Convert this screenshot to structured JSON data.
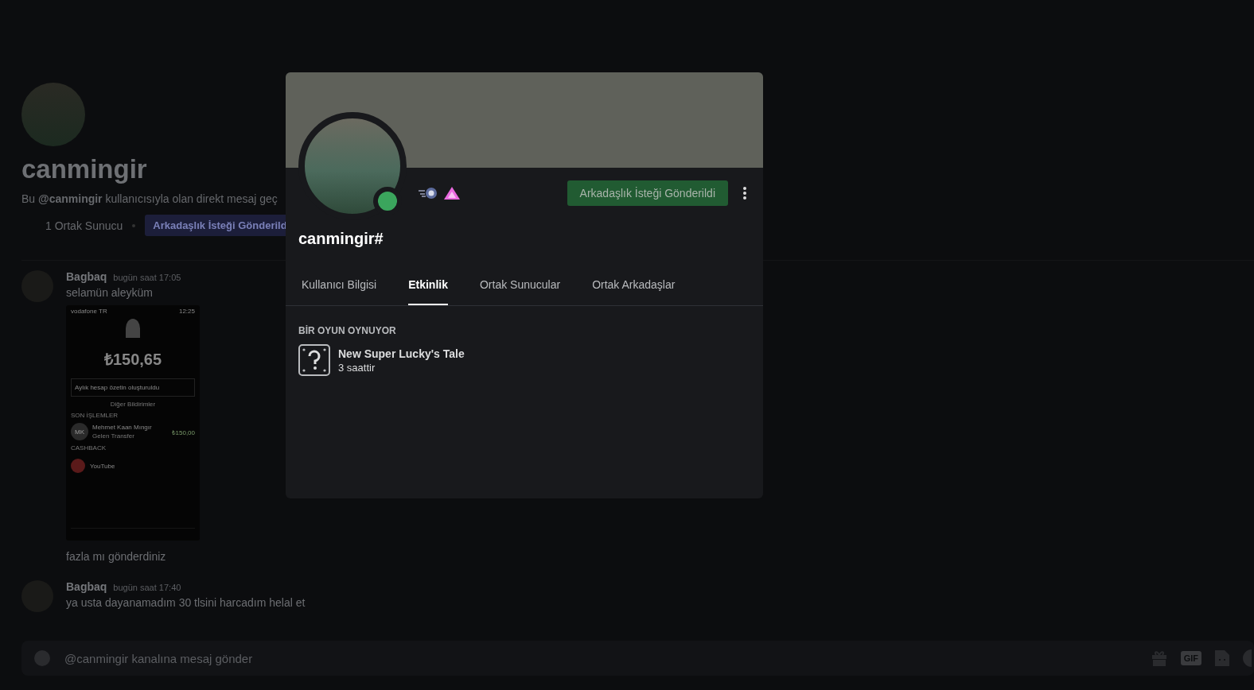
{
  "dm_header": {
    "name": "canmingir",
    "intro": "Bu **@canmingir** kullanıcısıyla olan direkt mesaj geç",
    "mutual_servers": "1 Ortak Sunucu",
    "friend_request_button": "Arkadaşlık İsteği Gönderild"
  },
  "messages": [
    {
      "author": "Bagbaq",
      "time": "bugün saat 17:05",
      "parts": [
        {
          "kind": "text",
          "text": "selamün aleyküm"
        },
        {
          "kind": "screenshot",
          "status_left": "vodafone TR",
          "status_time": "12:25",
          "balance": "₺150,65",
          "notice": "Aylık hesap özetin oluşturuldu",
          "more": "Diğer Bildirimler",
          "recent": "SON İŞLEMLER",
          "contact_initials": "MK",
          "contact_name": "Mehmet Kaan Mıngır",
          "contact_sub": "Gelen Transfer",
          "contact_amount": "₺150,00",
          "cashback": "CASHBACK",
          "promo": "YouTube"
        },
        {
          "kind": "text",
          "text": "fazla mı gönderdiniz"
        }
      ]
    },
    {
      "author": "Bagbaq",
      "time": "bugün saat 17:40",
      "parts": [
        {
          "kind": "text",
          "text": "ya usta dayanamadım 30 tlsini harcadım helal et"
        }
      ]
    }
  ],
  "composer": {
    "placeholder": "@canmingir kanalına mesaj gönder",
    "gif_label": "GIF"
  },
  "profile": {
    "online": true,
    "name": "canmingir#",
    "friend_request_button": "Arkadaşlık İsteği Gönderildi",
    "tabs": [
      {
        "label": "Kullanıcı Bilgisi",
        "selected": false
      },
      {
        "label": "Etkinlik",
        "selected": true
      },
      {
        "label": "Ortak Sunucular",
        "selected": false
      },
      {
        "label": "Ortak Arkadaşlar",
        "selected": false
      }
    ],
    "activity": {
      "heading": "BİR OYUN OYNUYOR",
      "game": "New Super Lucky's Tale",
      "elapsed": "3 saattir"
    }
  }
}
